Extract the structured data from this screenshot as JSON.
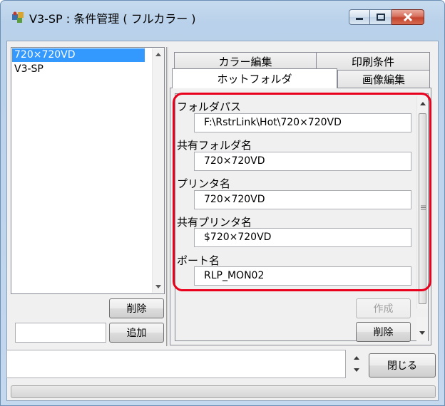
{
  "window": {
    "title": "V3-SP : 条件管理 ( フルカラー )",
    "icons": {
      "app": "puzzle-app-icon",
      "minimize": "minimize-icon",
      "maximize": "maximize-icon",
      "close": "close-icon"
    }
  },
  "list": {
    "items": [
      "720×720VD",
      "V3-SP"
    ],
    "selected_index": 0
  },
  "left_buttons": {
    "delete": "削除",
    "add": "追加",
    "add_input": ""
  },
  "tabs": {
    "row_back": [
      "カラー編集",
      "印刷条件"
    ],
    "row_front": [
      "ホットフォルダ",
      "画像編集"
    ],
    "active": "ホットフォルダ"
  },
  "fields": [
    {
      "label": "フォルダパス",
      "value": "F:\\RstrLink\\Hot\\720×720VD"
    },
    {
      "label": "共有フォルダ名",
      "value": "720×720VD"
    },
    {
      "label": "プリンタ名",
      "value": "720×720VD"
    },
    {
      "label": "共有プリンタ名",
      "value": "$720×720VD"
    },
    {
      "label": "ポート名",
      "value": "RLP_MON02"
    }
  ],
  "panel_buttons": {
    "create": "作成",
    "delete": "削除"
  },
  "bottom": {
    "message": "",
    "close_button": "閉じる"
  },
  "colors": {
    "selection": "#3399ff",
    "highlight_outline": "#e8001c",
    "close_button": "#c4452f"
  }
}
